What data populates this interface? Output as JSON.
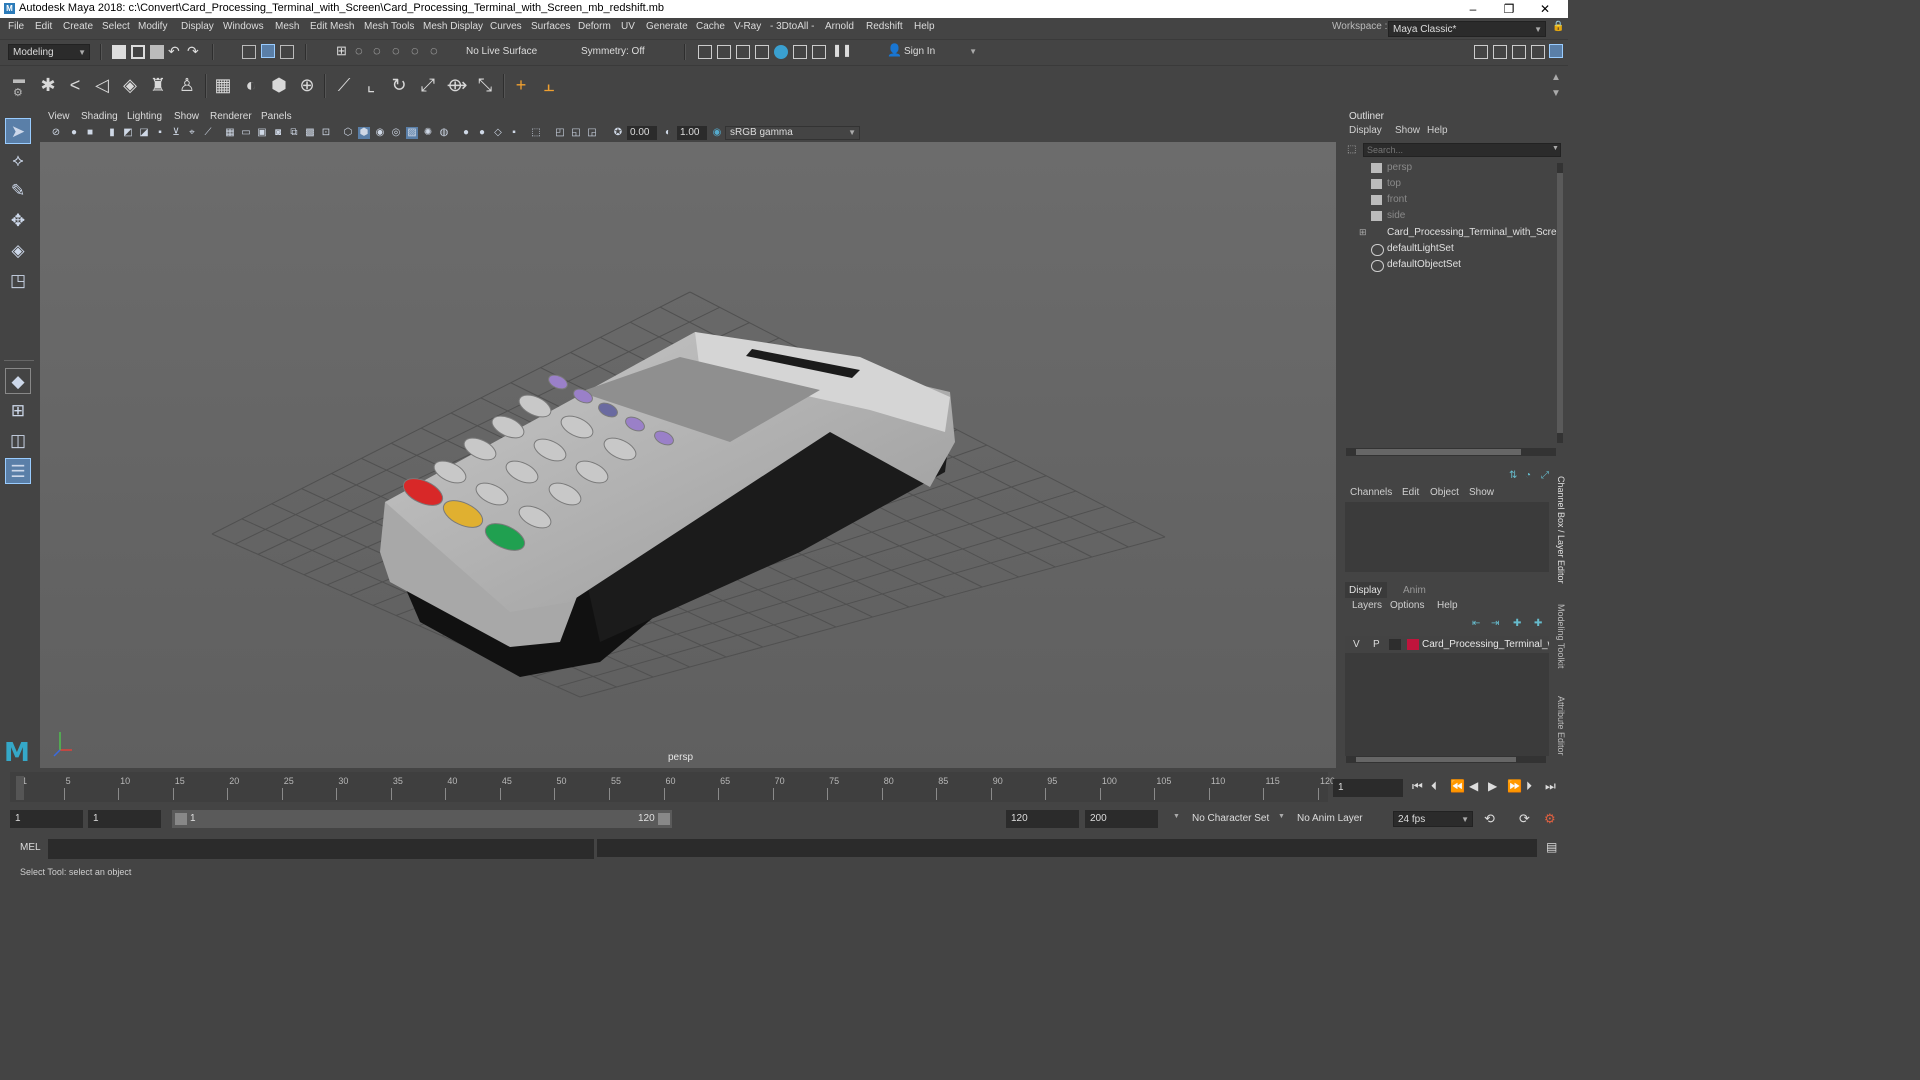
{
  "window": {
    "title": "Autodesk Maya 2018: c:\\Convert\\Card_Processing_Terminal_with_Screen\\Card_Processing_Terminal_with_Screen_mb_redshift.mb",
    "minimize": "–",
    "maximize": "❐",
    "close": "✕"
  },
  "menu": [
    "File",
    "Edit",
    "Create",
    "Select",
    "Modify",
    "Display",
    "Windows",
    "Mesh",
    "Edit Mesh",
    "Mesh Tools",
    "Mesh Display",
    "Curves",
    "Surfaces",
    "Deform",
    "UV",
    "Generate",
    "Cache",
    "V-Ray",
    "- 3DtoAll -",
    "Arnold",
    "Redshift",
    "Help"
  ],
  "workspace": {
    "label": "Workspace :",
    "value": "Maya Classic*"
  },
  "toolbar": {
    "mode": "Modeling",
    "live_surface": "No Live Surface",
    "symmetry": "Symmetry: Off",
    "sign_in": "Sign In"
  },
  "viewport": {
    "menu": [
      "View",
      "Shading",
      "Lighting",
      "Show",
      "Renderer",
      "Panels"
    ],
    "exposure": "0.00",
    "gamma": "1.00",
    "color_space": "sRGB gamma",
    "camera_label": "persp"
  },
  "outliner": {
    "title": "Outliner",
    "menu": [
      "Display",
      "Show",
      "Help"
    ],
    "search_placeholder": "Search...",
    "items": [
      {
        "label": "persp",
        "type": "camera",
        "dim": true
      },
      {
        "label": "top",
        "type": "camera",
        "dim": true
      },
      {
        "label": "front",
        "type": "camera",
        "dim": true
      },
      {
        "label": "side",
        "type": "camera",
        "dim": true
      },
      {
        "label": "Card_Processing_Terminal_with_Screen_",
        "type": "group",
        "dim": false
      },
      {
        "label": "defaultLightSet",
        "type": "set",
        "dim": false
      },
      {
        "label": "defaultObjectSet",
        "type": "set",
        "dim": false
      }
    ]
  },
  "channel_box": {
    "menu": [
      "Channels",
      "Edit",
      "Object",
      "Show"
    ],
    "tabs": [
      "Display",
      "Anim"
    ],
    "layer_menu": [
      "Layers",
      "Options",
      "Help"
    ],
    "layer": {
      "v": "V",
      "p": "P",
      "name": "Card_Processing_Terminal_with",
      "color": "#c0143c"
    }
  },
  "side_tabs": [
    "Channel Box / Layer Editor",
    "Modeling Toolkit",
    "Attribute Editor"
  ],
  "timeline": {
    "ticks": [
      "1",
      "5",
      "10",
      "15",
      "20",
      "25",
      "30",
      "35",
      "40",
      "45",
      "50",
      "55",
      "60",
      "65",
      "70",
      "75",
      "80",
      "85",
      "90",
      "95",
      "100",
      "105",
      "110",
      "115",
      "120"
    ],
    "current_frame": "1"
  },
  "range": {
    "start": "1",
    "start2": "1",
    "slider_start": "1",
    "slider_end": "120",
    "end": "120",
    "end2": "200",
    "character_set": "No Character Set",
    "anim_layer": "No Anim Layer",
    "fps": "24 fps"
  },
  "mel": {
    "label": "MEL"
  },
  "status": "Select Tool: select an object"
}
